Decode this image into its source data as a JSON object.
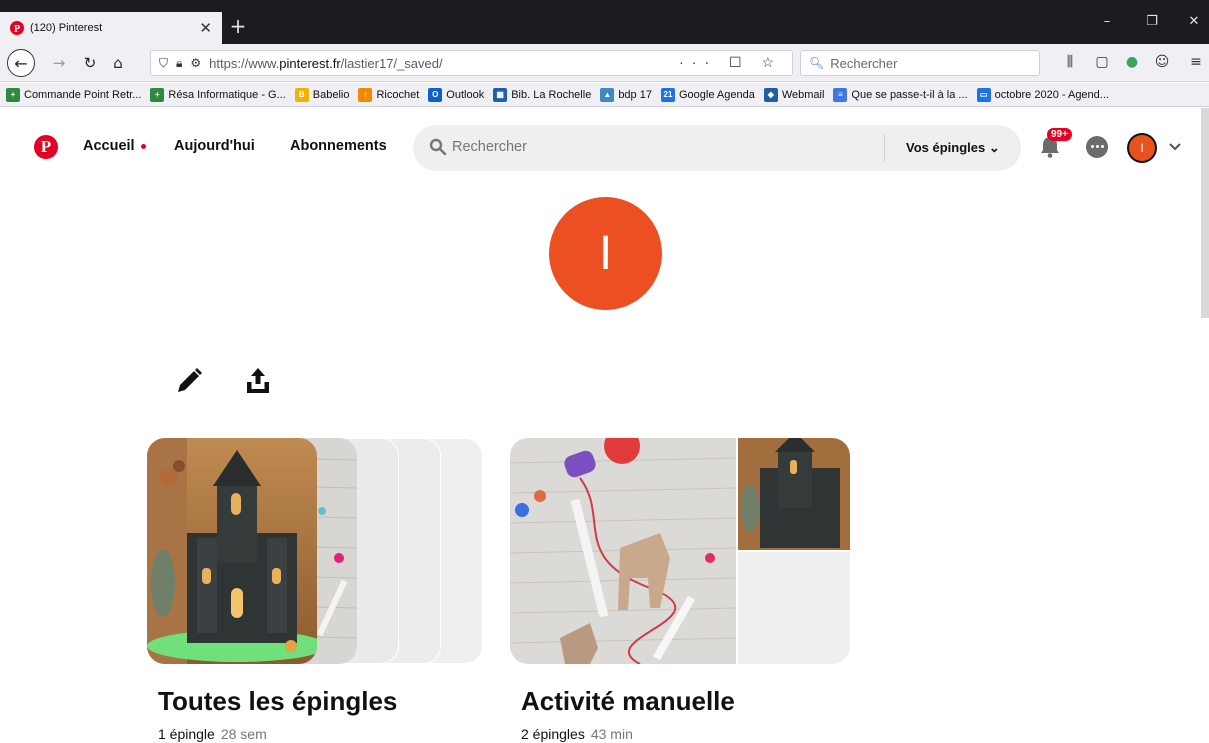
{
  "browser": {
    "tab_title": "(120) Pinterest",
    "tab_close": "✕",
    "new_tab": "+",
    "url_prefix": "https://www.",
    "url_domain": "pinterest.fr",
    "url_path": "/lastier17/_saved/",
    "url_actions": "··· ☐ ☆",
    "search_placeholder": "Rechercher",
    "bookmarks": [
      {
        "label": "Commande Point Retr...",
        "color": "#2d8a3e",
        "glyph": "+"
      },
      {
        "label": "Résa Informatique - G...",
        "color": "#2d8a3e",
        "glyph": "+"
      },
      {
        "label": "Babelio",
        "color": "#f0b400",
        "glyph": "B"
      },
      {
        "label": "Ricochet",
        "color": "#f08a00",
        "glyph": "↑"
      },
      {
        "label": "Outlook",
        "color": "#0a64c8",
        "glyph": "O"
      },
      {
        "label": "Bib. La Rochelle",
        "color": "#1e5fb0",
        "glyph": "▦"
      },
      {
        "label": "bdp 17",
        "color": "#3a8ac8",
        "glyph": "▲"
      },
      {
        "label": "Google Agenda",
        "color": "#1a73e8",
        "glyph": "21"
      },
      {
        "label": "Webmail",
        "color": "#1e5fa0",
        "glyph": "◆"
      },
      {
        "label": "Que se passe-t-il à la ...",
        "color": "#3b78e7",
        "glyph": "≡"
      },
      {
        "label": "octobre 2020 - Agend...",
        "color": "#1a73e8",
        "glyph": "▭"
      }
    ]
  },
  "pinterest": {
    "logo": "P",
    "nav": {
      "home": "Accueil",
      "today": "Aujourd'hui",
      "following": "Abonnements"
    },
    "search": {
      "placeholder": "Rechercher",
      "filter": "Vos épingles"
    },
    "notifications_badge": "99+",
    "avatar_initial": "I",
    "profile_initial": "I",
    "boards": [
      {
        "title": "Toutes les épingles",
        "count": "1 épingle",
        "age": "28 sem"
      },
      {
        "title": "Activité manuelle",
        "count": "2 épingles",
        "age": "43 min"
      }
    ]
  },
  "colors": {
    "pinterest_red": "#e60023",
    "avatar_orange": "#ec5022"
  }
}
